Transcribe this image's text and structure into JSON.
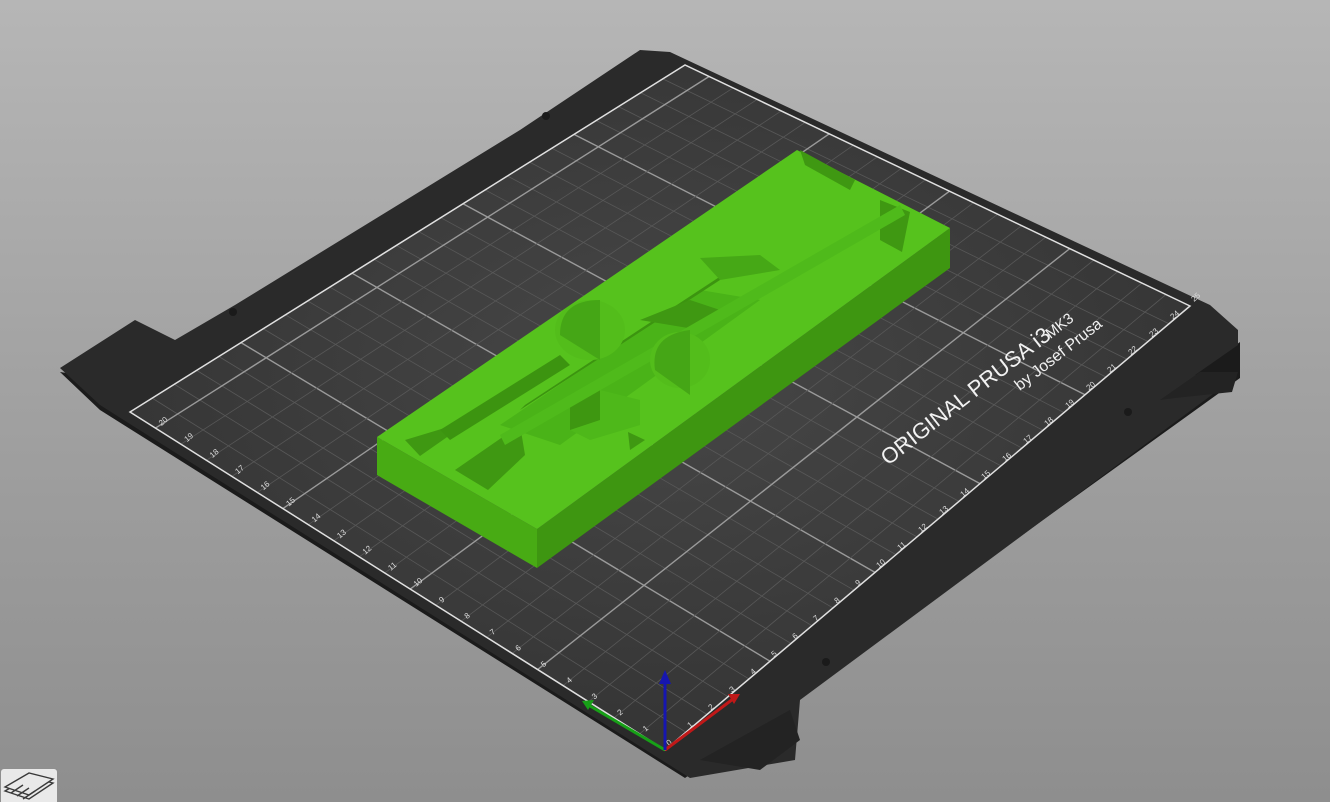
{
  "bed": {
    "title": "ORIGINAL PRUSA i3",
    "model": "MK3",
    "author": "by Josef Prusa",
    "ruler_x_labels": [
      "0",
      "1",
      "2",
      "3",
      "4",
      "5",
      "6",
      "7",
      "8",
      "9",
      "10",
      "11",
      "12",
      "13",
      "14",
      "15",
      "16",
      "17",
      "18",
      "19",
      "20",
      "21",
      "22",
      "23",
      "24",
      "25"
    ],
    "ruler_y_labels": [
      "1",
      "2",
      "3",
      "4",
      "5",
      "6",
      "7",
      "8",
      "9",
      "10",
      "11",
      "12",
      "13",
      "14",
      "15",
      "16",
      "17",
      "18",
      "19",
      "20"
    ]
  },
  "colors": {
    "background_top": "#b6b6b6",
    "background_bottom": "#8e8e8e",
    "bed_plate": "#2b2b2b",
    "grid_area": "#3a3a3a",
    "model_top": "#55c01c",
    "model_side": "#3f9a12",
    "axis_x": "#c01818",
    "axis_y": "#17a017",
    "axis_z": "#1616b0"
  },
  "icons": {
    "layers": "layers-icon"
  }
}
